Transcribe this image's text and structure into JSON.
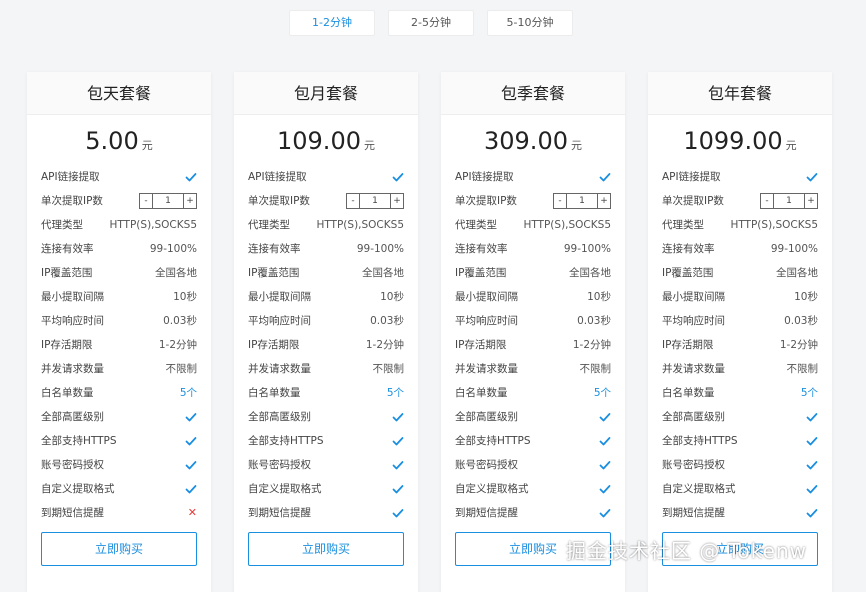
{
  "tabs": [
    {
      "label": "1-2分钟",
      "active": true
    },
    {
      "label": "2-5分钟",
      "active": false
    },
    {
      "label": "5-10分钟",
      "active": false
    }
  ],
  "feature_labels": [
    "API链接提取",
    "单次提取IP数",
    "代理类型",
    "连接有效率",
    "IP覆盖范围",
    "最小提取间隔",
    "平均响应时间",
    "IP存活期限",
    "并发请求数量",
    "白名单数量",
    "全部高匿级别",
    "全部支持HTTPS",
    "账号密码授权",
    "自定义提取格式",
    "到期短信提醒"
  ],
  "plans": [
    {
      "title": "包天套餐",
      "price": "5.00",
      "unit": "元",
      "values": [
        "check",
        "stepper",
        "HTTP(S),SOCKS5",
        "99-100%",
        "全国各地",
        "10秒",
        "0.03秒",
        "1-2分钟",
        "不限制",
        "5个",
        "check",
        "check",
        "check",
        "check",
        "cross"
      ],
      "buy_label": "立即购买",
      "stepper": {
        "minus": "-",
        "value": "1",
        "plus": "+"
      }
    },
    {
      "title": "包月套餐",
      "price": "109.00",
      "unit": "元",
      "values": [
        "check",
        "stepper",
        "HTTP(S),SOCKS5",
        "99-100%",
        "全国各地",
        "10秒",
        "0.03秒",
        "1-2分钟",
        "不限制",
        "5个",
        "check",
        "check",
        "check",
        "check",
        "check"
      ],
      "buy_label": "立即购买",
      "stepper": {
        "minus": "-",
        "value": "1",
        "plus": "+"
      }
    },
    {
      "title": "包季套餐",
      "price": "309.00",
      "unit": "元",
      "values": [
        "check",
        "stepper",
        "HTTP(S),SOCKS5",
        "99-100%",
        "全国各地",
        "10秒",
        "0.03秒",
        "1-2分钟",
        "不限制",
        "5个",
        "check",
        "check",
        "check",
        "check",
        "check"
      ],
      "buy_label": "立即购买",
      "stepper": {
        "minus": "-",
        "value": "1",
        "plus": "+"
      }
    },
    {
      "title": "包年套餐",
      "price": "1099.00",
      "unit": "元",
      "values": [
        "check",
        "stepper",
        "HTTP(S),SOCKS5",
        "99-100%",
        "全国各地",
        "10秒",
        "0.03秒",
        "1-2分钟",
        "不限制",
        "5个",
        "check",
        "check",
        "check",
        "check",
        "check"
      ],
      "buy_label": "立即购买",
      "stepper": {
        "minus": "-",
        "value": "1",
        "plus": "+"
      }
    }
  ],
  "watermark": "掘金技术社区 @ Tokenw",
  "colors": {
    "accent": "#1a8fe0",
    "cross": "#e23b3b"
  }
}
